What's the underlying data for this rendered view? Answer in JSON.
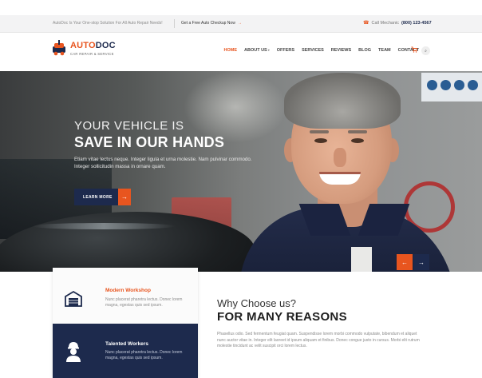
{
  "topbar": {
    "promo": "AutoDoc Is Your One-stop Solution For All Auto Repair Needs!",
    "cta": "Get a Free Auto Checkup Now",
    "cta_arrow": "→",
    "phone_label": "Call Mechanic",
    "phone_number": "(800) 123-4567",
    "phone_icon": "☎"
  },
  "header": {
    "logo_auto": "AUTO",
    "logo_doc": "DOC",
    "logo_tagline": "CAR REPAIR & SERVICE",
    "nav": [
      {
        "label": "HOME"
      },
      {
        "label": "ABOUT US"
      },
      {
        "label": "OFFERS"
      },
      {
        "label": "SERVICES"
      },
      {
        "label": "REVIEWS"
      },
      {
        "label": "BLOG"
      },
      {
        "label": "TEAM"
      },
      {
        "label": "CONTACT"
      }
    ],
    "caret": "▾",
    "cart_icon": "🛒",
    "search_icon": "⌕"
  },
  "hero": {
    "kicker": "YOUR VEHICLE IS",
    "headline": "SAVE IN OUR HANDS",
    "subtext": "Etiam vitae lectus neque. Integer ligula et urna molestie. Nam pulvinar commodo. Integer sollicitudin massa in ornare quam.",
    "button_label": "LEARN MORE",
    "button_arrow": "→",
    "prev_arrow": "←",
    "next_arrow": "→"
  },
  "features": [
    {
      "title": "Modern Workshop",
      "desc": "Nunc placerat pharetra lectus. Donec lorem magna, egestas quis sed ipsum."
    },
    {
      "title": "Talented Workers",
      "desc": "Nunc placerat pharetra lectus. Donec lorem magna, egestas quis sed ipsum."
    }
  ],
  "why": {
    "pre": "Why Choose us?",
    "title": "FOR MANY REASONS",
    "body": "Phasellus odio. Sed fermentum feugiat quam. Suspendisse lorem morbi commodo vulputate, bibendum et aliquet nunc auctor vitae in. Integer elit laoreet id ipsum aliquam et finibus. Donec congue justo in cursus. Morbi elit rutrum molestie tincidunt ac velit suscipit orci lorem lectus."
  },
  "colors": {
    "accent": "#e8551f",
    "navy": "#1d2a4d"
  }
}
